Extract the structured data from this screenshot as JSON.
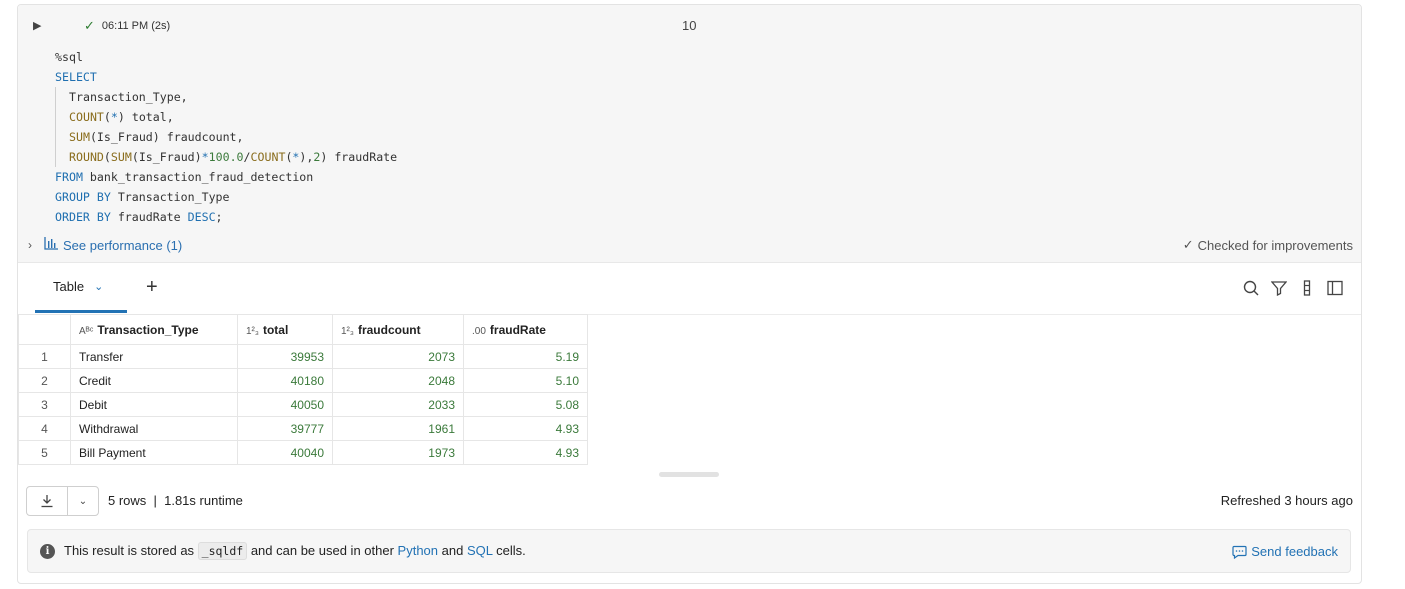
{
  "cell": {
    "status_time": "06:11 PM (2s)",
    "cell_number": "10",
    "code_lines": [
      [
        {
          "t": "%sql",
          "c": ""
        }
      ],
      [
        {
          "t": "SELECT",
          "c": "kw"
        }
      ],
      [
        {
          "t": "Transaction_Type,",
          "c": ""
        }
      ],
      [
        {
          "t": "COUNT",
          "c": "fn"
        },
        {
          "t": "(",
          "c": ""
        },
        {
          "t": "*",
          "c": "kw"
        },
        {
          "t": ")",
          "c": ""
        },
        {
          "t": " total,",
          "c": ""
        }
      ],
      [
        {
          "t": "SUM",
          "c": "fn"
        },
        {
          "t": "(Is_Fraud) fraudcount,",
          "c": ""
        }
      ],
      [
        {
          "t": "ROUND",
          "c": "fn"
        },
        {
          "t": "(",
          "c": ""
        },
        {
          "t": "SUM",
          "c": "fn"
        },
        {
          "t": "(Is_Fraud)",
          "c": ""
        },
        {
          "t": "*",
          "c": "kw"
        },
        {
          "t": "100.0",
          "c": "num"
        },
        {
          "t": "/",
          "c": ""
        },
        {
          "t": "COUNT",
          "c": "fn"
        },
        {
          "t": "(",
          "c": ""
        },
        {
          "t": "*",
          "c": "kw"
        },
        {
          "t": "),",
          "c": ""
        },
        {
          "t": "2",
          "c": "num"
        },
        {
          "t": ") fraudRate",
          "c": ""
        }
      ],
      [
        {
          "t": "FROM",
          "c": "kw"
        },
        {
          "t": " bank_transaction_fraud_detection",
          "c": ""
        }
      ],
      [
        {
          "t": "GROUP BY",
          "c": "kw"
        },
        {
          "t": " Transaction_Type",
          "c": ""
        }
      ],
      [
        {
          "t": "ORDER BY",
          "c": "kw"
        },
        {
          "t": " fraudRate ",
          "c": ""
        },
        {
          "t": "DESC",
          "c": "kw"
        },
        {
          "t": ";",
          "c": ""
        }
      ]
    ],
    "indented_lines": [
      2,
      3,
      4,
      5
    ],
    "see_performance": "See performance (1)",
    "checked_label": "Checked for improvements"
  },
  "tabs": {
    "table_label": "Table",
    "add_label": "+"
  },
  "table": {
    "columns": [
      {
        "icon": "Aᴮᶜ",
        "label": "Transaction_Type"
      },
      {
        "icon": "1²₃",
        "label": "total"
      },
      {
        "icon": "1²₃",
        "label": "fraudcount"
      },
      {
        "icon": ".00",
        "label": "fraudRate"
      }
    ],
    "rows": [
      {
        "n": "1",
        "type": "Transfer",
        "total": "39953",
        "fraudcount": "2073",
        "fraudRate": "5.19"
      },
      {
        "n": "2",
        "type": "Credit",
        "total": "40180",
        "fraudcount": "2048",
        "fraudRate": "5.10"
      },
      {
        "n": "3",
        "type": "Debit",
        "total": "40050",
        "fraudcount": "2033",
        "fraudRate": "5.08"
      },
      {
        "n": "4",
        "type": "Withdrawal",
        "total": "39777",
        "fraudcount": "1961",
        "fraudRate": "4.93"
      },
      {
        "n": "5",
        "type": "Bill Payment",
        "total": "40040",
        "fraudcount": "1973",
        "fraudRate": "4.93"
      }
    ]
  },
  "footer": {
    "rows_info": "5 rows  |  1.81s runtime",
    "refreshed": "Refreshed 3 hours ago"
  },
  "notice": {
    "prefix": "This result is stored as ",
    "var_name": "_sqldf",
    "middle": " and can be used in other ",
    "link_python": "Python",
    "and": " and ",
    "link_sql": "SQL",
    "suffix": " cells.",
    "feedback": "Send feedback"
  },
  "colors": {
    "accent": "#2272b4",
    "success": "#2e7d32",
    "keyword": "#1f6fb0"
  }
}
